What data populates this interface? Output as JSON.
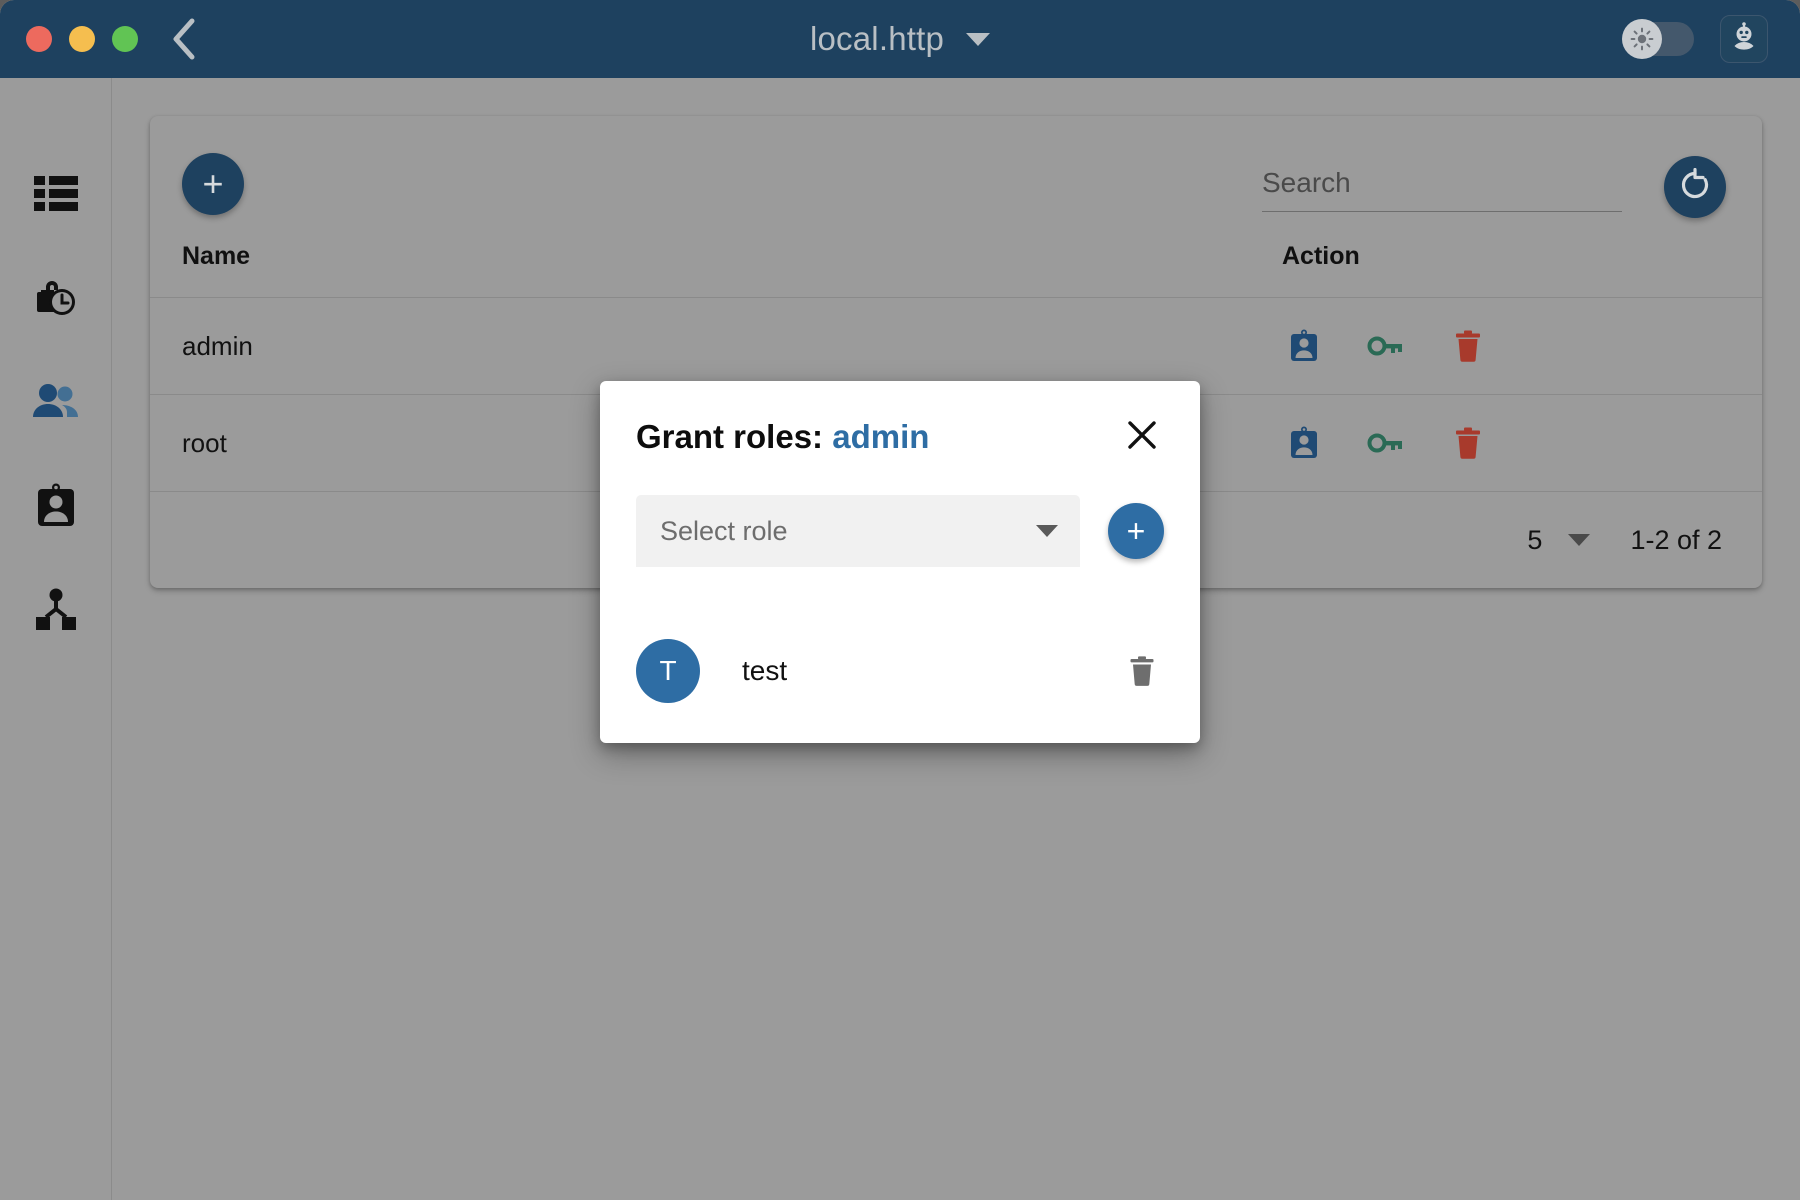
{
  "window": {
    "title": "local.http",
    "traffic_lights": [
      "close-red",
      "minimize-yellow",
      "maximize-green"
    ],
    "back_icon": "chevron-left-icon",
    "title_caret_icon": "chevron-down-icon",
    "theme_toggle_icon": "brightness-icon",
    "bot_icon": "robot-icon"
  },
  "sidebar": {
    "items": [
      {
        "name": "list-icon",
        "active": false
      },
      {
        "name": "lock-clock-icon",
        "active": false
      },
      {
        "name": "people-icon",
        "active": true
      },
      {
        "name": "badge-icon",
        "active": false
      },
      {
        "name": "account-tree-icon",
        "active": false
      }
    ]
  },
  "toolbar": {
    "add_label": "+",
    "refresh_icon": "refresh-icon",
    "search": {
      "placeholder": "Search",
      "value": ""
    }
  },
  "table": {
    "columns": [
      "Name",
      "Action"
    ],
    "rows": [
      {
        "name": "admin",
        "actions": [
          "badge-icon",
          "key-icon",
          "delete-icon"
        ]
      },
      {
        "name": "root",
        "actions": [
          "badge-icon",
          "key-icon",
          "delete-icon"
        ]
      }
    ]
  },
  "paginator": {
    "page_size": "5",
    "page_size_caret": "chevron-down-icon",
    "range_label": "1-2 of 2"
  },
  "modal": {
    "title_prefix": "Grant roles:",
    "subject": "admin",
    "close_icon": "close-icon",
    "select": {
      "placeholder": "Select role",
      "caret_icon": "chevron-down-icon"
    },
    "add_label": "+",
    "granted_roles": [
      {
        "initial": "T",
        "name": "test",
        "delete_icon": "delete-icon"
      }
    ]
  },
  "colors": {
    "titlebar": "#1e415f",
    "accent": "#2e6da4",
    "page_bg": "#9b9b9b",
    "action_badge": "#1f4a74",
    "action_key": "#2a6a55",
    "action_delete": "#a83a2c"
  }
}
